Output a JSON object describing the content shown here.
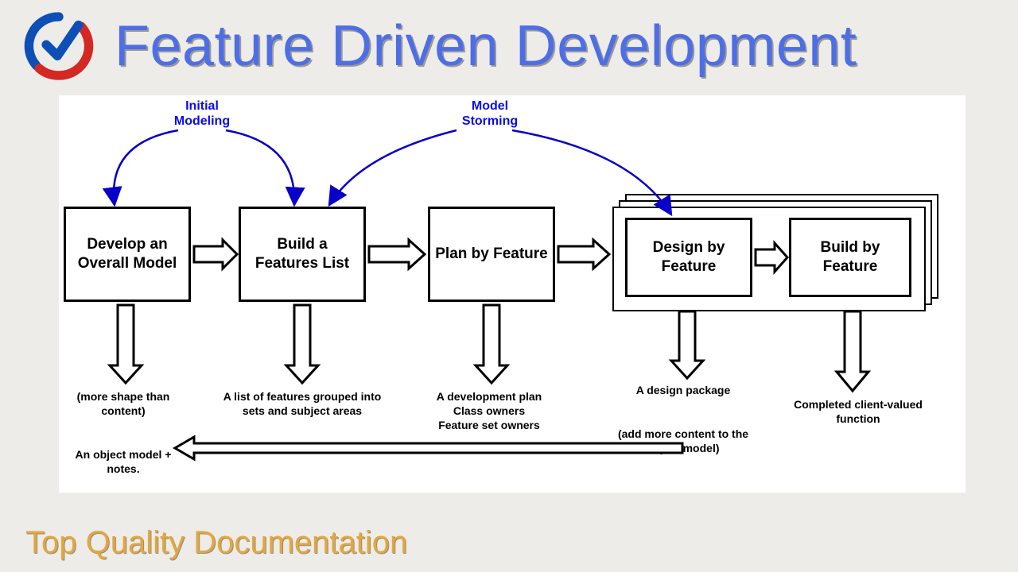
{
  "title": "Feature Driven Development",
  "footer": "Top Quality Documentation",
  "annotations": {
    "initial_modeling": "Initial\nModeling",
    "model_storming": "Model\nStorming"
  },
  "steps": [
    {
      "label": "Develop an Overall Model"
    },
    {
      "label": "Build a Features List"
    },
    {
      "label": "Plan by Feature"
    },
    {
      "label": "Design by Feature"
    },
    {
      "label": "Build by Feature"
    }
  ],
  "outputs": {
    "develop": "(more shape than content)\n\nAn object model + notes.",
    "build_list": "A list of features grouped into sets and subject areas",
    "plan": "A development plan\nClass owners\nFeature set owners",
    "design": "A design package\n\n(add more content to the object model)",
    "build_feature": "Completed client-valued function"
  }
}
